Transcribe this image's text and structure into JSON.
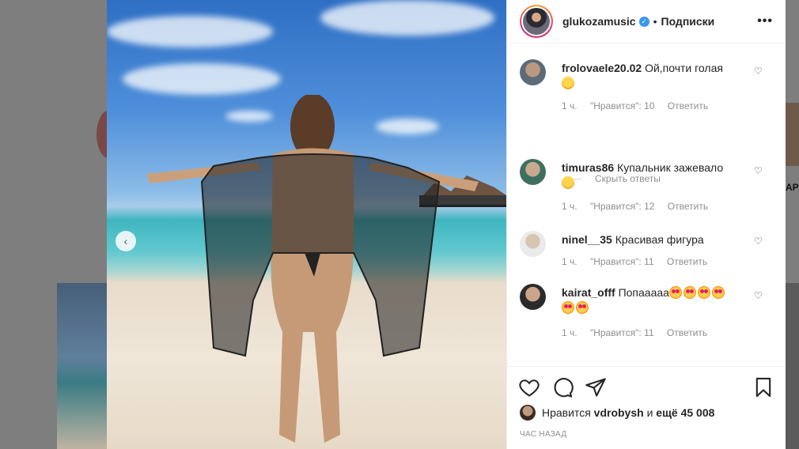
{
  "post": {
    "username": "glukozamusic",
    "separator": "•",
    "follow_label": "Подписки",
    "more_label": "•••",
    "verified_mark": "✓"
  },
  "comments": [
    {
      "user": "frolovaele20.02",
      "text": "Ой,почти голая",
      "time": "1 ч.",
      "likes": "\"Нравится\": 10",
      "reply": "Ответить"
    },
    {
      "user": "timuras86",
      "text": "Купальник зажевало",
      "time": "1 ч.",
      "likes": "\"Нравится\": 12",
      "reply": "Ответить"
    },
    {
      "user": "ninel__35",
      "text": "Красивая фигура",
      "time": "1 ч.",
      "likes": "\"Нравится\": 11",
      "reply": "Ответить"
    },
    {
      "user": "kairat_offf",
      "text": "Попааааа",
      "time": "1 ч.",
      "likes": "\"Нравится\": 11",
      "reply": "Ответить"
    }
  ],
  "hide_replies": "Скрыть ответы",
  "likes": {
    "prefix": "Нравится",
    "user": "vdrobysh",
    "middle": "и",
    "count": "ещё 45 008"
  },
  "timestamp": "ЧАС НАЗАД",
  "bg_text": "APz",
  "icons": {
    "prev": "chevron-left-icon",
    "heart": "heart-icon",
    "comment": "comment-icon",
    "share": "share-icon",
    "save": "bookmark-icon"
  },
  "colors": {
    "verified": "#3897f0",
    "text": "#262626",
    "secondary": "#8e8e8e"
  }
}
